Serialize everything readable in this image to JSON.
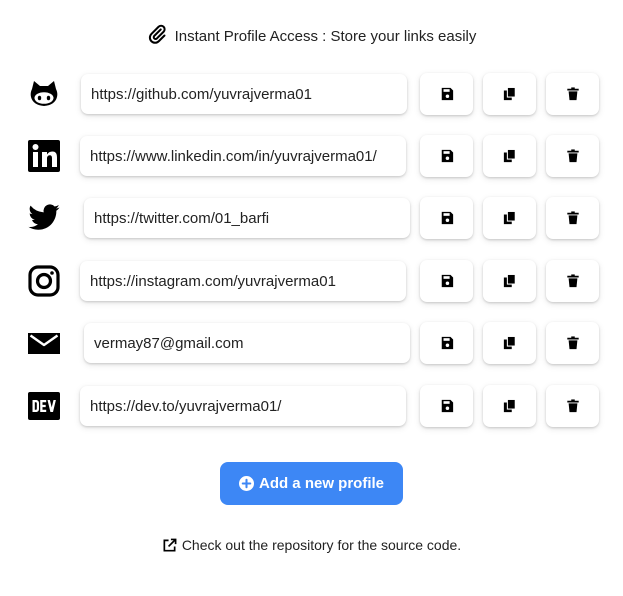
{
  "header": {
    "text": "Instant Profile Access : Store your links easily",
    "icon": "paperclip-icon"
  },
  "profiles": [
    {
      "icon": "github-icon",
      "value": "https://github.com/yuvrajverma01"
    },
    {
      "icon": "linkedin-icon",
      "value": "https://www.linkedin.com/in/yuvrajverma01/"
    },
    {
      "icon": "twitter-icon",
      "value": "https://twitter.com/01_barfi"
    },
    {
      "icon": "instagram-icon",
      "value": "https://instagram.com/yuvrajverma01"
    },
    {
      "icon": "mail-icon",
      "value": "vermay87@gmail.com"
    },
    {
      "icon": "dev-icon",
      "value": "https://dev.to/yuvrajverma01/"
    }
  ],
  "row_buttons": {
    "save_icon": "save-icon",
    "copy_icon": "copy-icon",
    "delete_icon": "trash-icon"
  },
  "add_button": {
    "label": "Add a new profile",
    "icon": "plus-circle-icon"
  },
  "footer": {
    "text": "Check out the repository for the source code.",
    "icon": "external-link-icon"
  },
  "colors": {
    "accent": "#3d87f5",
    "icon": "#000000",
    "text": "#222222"
  }
}
